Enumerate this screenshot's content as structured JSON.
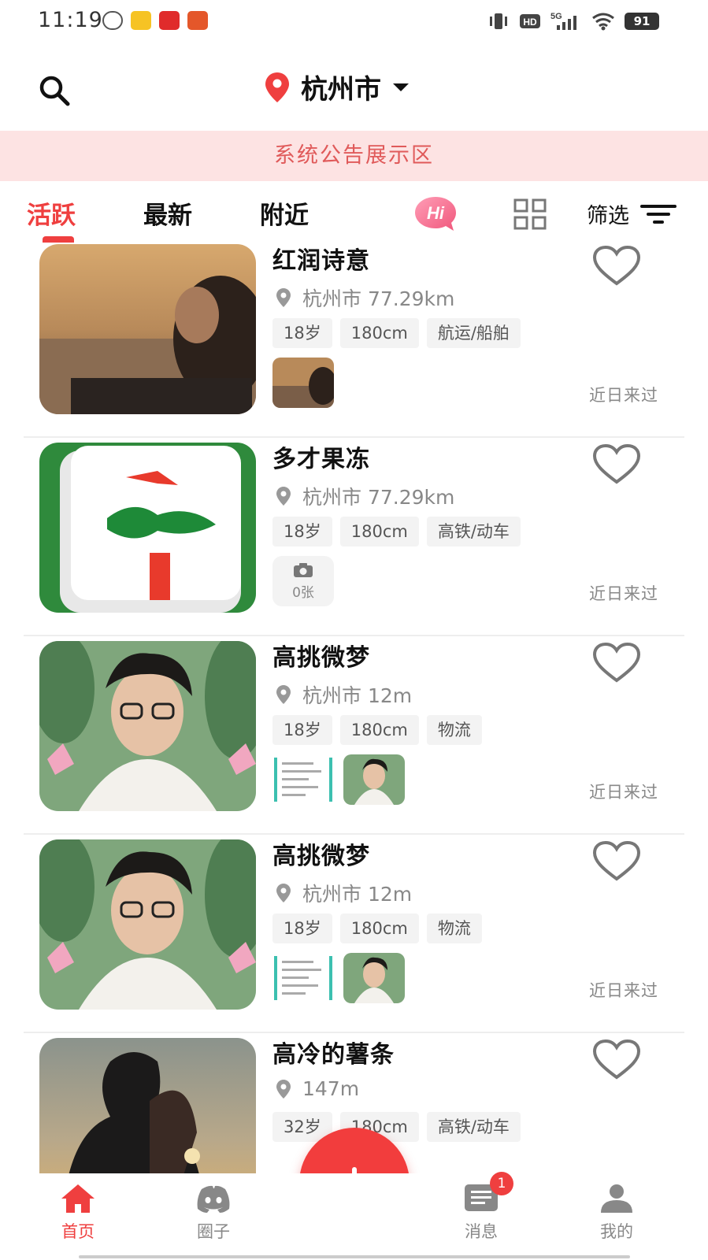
{
  "status_bar": {
    "time": "11:19",
    "network": "5G",
    "hd": "HD",
    "battery": "91"
  },
  "header": {
    "location": "杭州市"
  },
  "announcement": {
    "text": "系统公告展示区"
  },
  "tabs": [
    {
      "label": "活跃",
      "active": true
    },
    {
      "label": "最新",
      "active": false
    },
    {
      "label": "附近",
      "active": false
    }
  ],
  "hi_badge": "Hi",
  "filter_label": "筛选",
  "users": [
    {
      "name": "红润诗意",
      "location": "杭州市 77.29km",
      "tags": [
        "18岁",
        "180cm",
        "航运/船舶"
      ],
      "visited": "近日来过",
      "photo_count": null
    },
    {
      "name": "多才果冻",
      "location": "杭州市 77.29km",
      "tags": [
        "18岁",
        "180cm",
        "高铁/动车"
      ],
      "visited": "近日来过",
      "photo_count": "0张"
    },
    {
      "name": "高挑微梦",
      "location": "杭州市 12m",
      "tags": [
        "18岁",
        "180cm",
        "物流"
      ],
      "visited": "近日来过",
      "photo_count": null
    },
    {
      "name": "高挑微梦",
      "location": "杭州市 12m",
      "tags": [
        "18岁",
        "180cm",
        "物流"
      ],
      "visited": "近日来过",
      "photo_count": null
    },
    {
      "name": "高冷的薯条",
      "location": "147m",
      "tags": [
        "32岁",
        "180cm",
        "高铁/动车"
      ],
      "visited": "",
      "photo_count": null
    }
  ],
  "bottom_nav": [
    {
      "label": "首页",
      "icon": "home-icon",
      "active": true
    },
    {
      "label": "圈子",
      "icon": "discord-icon",
      "active": false
    },
    {
      "label": "消息",
      "icon": "message-icon",
      "active": false,
      "badge": "1"
    },
    {
      "label": "我的",
      "icon": "person-icon",
      "active": false
    }
  ],
  "colors": {
    "accent": "#ef3f3f",
    "announcement_bg": "#fde3e3",
    "announcement_text": "#e05a5a"
  }
}
